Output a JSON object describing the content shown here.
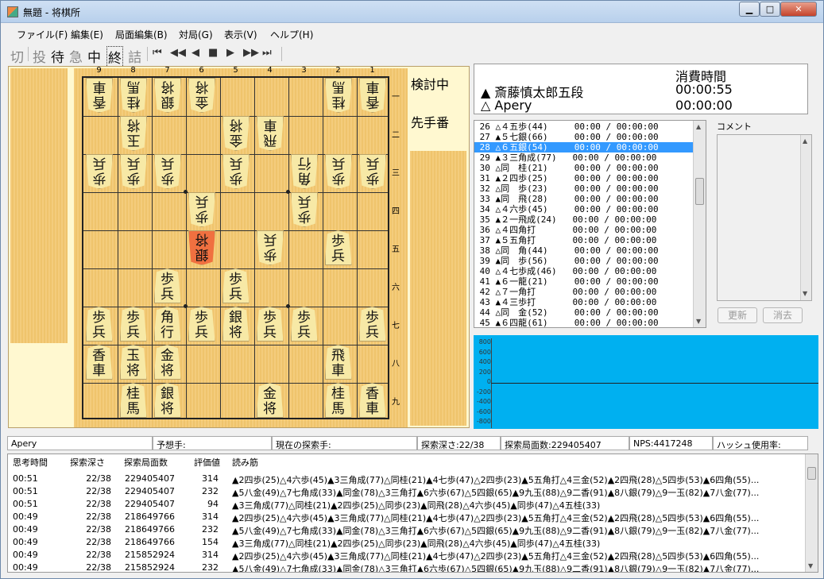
{
  "window": {
    "title": "無題 - 将棋所",
    "min": "▁",
    "max": "□",
    "close": "✕"
  },
  "menu": [
    "ファイル(F)",
    "編集(E)",
    "局面編集(B)",
    "対局(G)",
    "表示(V)",
    "ヘルプ(H)"
  ],
  "toolbar": {
    "buttons": [
      "切",
      "投",
      "待",
      "急",
      "中",
      "終",
      "詰"
    ],
    "nav": [
      "⏮",
      "◀◀",
      "◀",
      "■",
      "▶",
      "▶▶",
      "⏭"
    ]
  },
  "board": {
    "files": [
      "9",
      "8",
      "7",
      "6",
      "5",
      "4",
      "3",
      "2",
      "1"
    ],
    "ranks": [
      "一",
      "二",
      "三",
      "四",
      "五",
      "六",
      "七",
      "八",
      "九"
    ],
    "pieces": [
      {
        "f": 9,
        "r": 1,
        "t": "香車",
        "g": true
      },
      {
        "f": 8,
        "r": 1,
        "t": "桂馬",
        "g": true
      },
      {
        "f": 7,
        "r": 1,
        "t": "銀将",
        "g": true
      },
      {
        "f": 6,
        "r": 1,
        "t": "金将",
        "g": true
      },
      {
        "f": 2,
        "r": 1,
        "t": "桂馬",
        "g": true
      },
      {
        "f": 1,
        "r": 1,
        "t": "香車",
        "g": true
      },
      {
        "f": 8,
        "r": 2,
        "t": "玉将",
        "g": true
      },
      {
        "f": 5,
        "r": 2,
        "t": "金将",
        "g": true
      },
      {
        "f": 4,
        "r": 2,
        "t": "飛車",
        "g": true
      },
      {
        "f": 9,
        "r": 3,
        "t": "歩兵",
        "g": true
      },
      {
        "f": 8,
        "r": 3,
        "t": "歩兵",
        "g": true
      },
      {
        "f": 7,
        "r": 3,
        "t": "歩兵",
        "g": true
      },
      {
        "f": 5,
        "r": 3,
        "t": "歩兵",
        "g": true
      },
      {
        "f": 3,
        "r": 3,
        "t": "角行",
        "g": true
      },
      {
        "f": 2,
        "r": 3,
        "t": "歩兵",
        "g": true
      },
      {
        "f": 1,
        "r": 3,
        "t": "歩兵",
        "g": true
      },
      {
        "f": 6,
        "r": 4,
        "t": "歩兵",
        "g": true
      },
      {
        "f": 3,
        "r": 4,
        "t": "歩兵",
        "g": true
      },
      {
        "f": 6,
        "r": 5,
        "t": "銀将",
        "g": true,
        "hl": true
      },
      {
        "f": 4,
        "r": 5,
        "t": "歩兵",
        "g": true
      },
      {
        "f": 2,
        "r": 5,
        "t": "歩兵",
        "g": false
      },
      {
        "f": 7,
        "r": 6,
        "t": "歩兵",
        "g": false
      },
      {
        "f": 5,
        "r": 6,
        "t": "歩兵",
        "g": false
      },
      {
        "f": 9,
        "r": 7,
        "t": "歩兵",
        "g": false
      },
      {
        "f": 8,
        "r": 7,
        "t": "歩兵",
        "g": false
      },
      {
        "f": 7,
        "r": 7,
        "t": "角行",
        "g": false
      },
      {
        "f": 6,
        "r": 7,
        "t": "歩兵",
        "g": false
      },
      {
        "f": 5,
        "r": 7,
        "t": "銀将",
        "g": false
      },
      {
        "f": 4,
        "r": 7,
        "t": "歩兵",
        "g": false
      },
      {
        "f": 3,
        "r": 7,
        "t": "歩兵",
        "g": false
      },
      {
        "f": 1,
        "r": 7,
        "t": "歩兵",
        "g": false
      },
      {
        "f": 9,
        "r": 8,
        "t": "香車",
        "g": false
      },
      {
        "f": 8,
        "r": 8,
        "t": "玉将",
        "g": false
      },
      {
        "f": 7,
        "r": 8,
        "t": "金将",
        "g": false
      },
      {
        "f": 2,
        "r": 8,
        "t": "飛車",
        "g": false
      },
      {
        "f": 8,
        "r": 9,
        "t": "桂馬",
        "g": false
      },
      {
        "f": 7,
        "r": 9,
        "t": "銀将",
        "g": false
      },
      {
        "f": 4,
        "r": 9,
        "t": "金将",
        "g": false
      },
      {
        "f": 2,
        "r": 9,
        "t": "桂馬",
        "g": false
      },
      {
        "f": 1,
        "r": 9,
        "t": "香車",
        "g": false
      }
    ]
  },
  "side": {
    "mode": "検討中",
    "turn": "先手番"
  },
  "clock": {
    "header": "消費時間",
    "sente_name": "▲ 斎藤慎太郎五段",
    "sente_time": "00:00:55",
    "gote_name": "△ Apery",
    "gote_time": "00:00:00"
  },
  "moves": [
    " 26 △４五歩(44)     00:00 / 00:00:00",
    " 27 ▲５七銀(66)     00:00 / 00:00:00",
    " 28 △６五銀(54)     00:00 / 00:00:00",
    " 29 ▲３三角成(77)   00:00 / 00:00:00",
    " 30 △同　桂(21)     00:00 / 00:00:00",
    " 31 ▲２四歩(25)     00:00 / 00:00:00",
    " 32 △同　歩(23)     00:00 / 00:00:00",
    " 33 ▲同　飛(28)     00:00 / 00:00:00",
    " 34 △４六歩(45)     00:00 / 00:00:00",
    " 35 ▲２一飛成(24)   00:00 / 00:00:00",
    " 36 △４四角打       00:00 / 00:00:00",
    " 37 ▲５五角打       00:00 / 00:00:00",
    " 38 △同　角(44)     00:00 / 00:00:00",
    " 39 ▲同　歩(56)     00:00 / 00:00:00",
    " 40 △４七歩成(46)   00:00 / 00:00:00",
    " 41 ▲６一龍(21)     00:00 / 00:00:00",
    " 42 △７一角打       00:00 / 00:00:00",
    " 43 ▲４三歩打       00:00 / 00:00:00",
    " 44 △同　金(52)     00:00 / 00:00:00",
    " 45 ▲６四龍(61)     00:00 / 00:00:00"
  ],
  "selected_move": 2,
  "comment": {
    "label": "コメント",
    "update": "更新",
    "clear": "消去"
  },
  "graph": {
    "yticks": [
      "800",
      "600",
      "400",
      "200",
      "0",
      "-200",
      "-400",
      "-600",
      "-800"
    ]
  },
  "status": {
    "engine": "Apery",
    "predict": "予想手:",
    "current": "現在の探索手:",
    "depth": "探索深さ:22/38",
    "nodes": "探索局面数:229405407",
    "nps": "NPS:4417248",
    "hash": "ハッシュ使用率:"
  },
  "pv": {
    "headers": [
      "思考時間",
      "探索深さ",
      "探索局面数",
      "評価値",
      "読み筋"
    ],
    "rows": [
      [
        "00:51",
        "22/38",
        "229405407",
        "314",
        "▲2四歩(25)△4六歩(45)▲3三角成(77)△同桂(21)▲4七歩(47)△2四歩(23)▲5五角打△4三金(52)▲2四飛(28)△5四歩(53)▲6四角(55)..."
      ],
      [
        "00:51",
        "22/38",
        "229405407",
        "232",
        "▲5八金(49)△7七角成(33)▲同金(78)△3三角打▲6六歩(67)△5四銀(65)▲9九玉(88)△9二香(91)▲8八銀(79)△9一玉(82)▲7八金(77)..."
      ],
      [
        "00:51",
        "22/38",
        "229405407",
        "94",
        "▲3三角成(77)△同桂(21)▲2四歩(25)△同歩(23)▲同飛(28)△4六歩(45)▲同歩(47)△4五桂(33)"
      ],
      [
        "00:49",
        "22/38",
        "218649766",
        "314",
        "▲2四歩(25)△4六歩(45)▲3三角成(77)△同桂(21)▲4七歩(47)△2四歩(23)▲5五角打△4三金(52)▲2四飛(28)△5四歩(53)▲6四角(55)..."
      ],
      [
        "00:49",
        "22/38",
        "218649766",
        "232",
        "▲5八金(49)△7七角成(33)▲同金(78)△3三角打▲6六歩(67)△5四銀(65)▲9九玉(88)△9二香(91)▲8八銀(79)△9一玉(82)▲7八金(77)..."
      ],
      [
        "00:49",
        "22/38",
        "218649766",
        "154",
        "▲3三角成(77)△同桂(21)▲2四歩(25)△同歩(23)▲同飛(28)△4六歩(45)▲同歩(47)△4五桂(33)"
      ],
      [
        "00:49",
        "22/38",
        "215852924",
        "314",
        "▲2四歩(25)△4六歩(45)▲3三角成(77)△同桂(21)▲4七歩(47)△2四歩(23)▲5五角打△4三金(52)▲2四飛(28)△5四歩(53)▲6四角(55)..."
      ],
      [
        "00:49",
        "22/38",
        "215852924",
        "232",
        "▲5八金(49)△7七角成(33)▲同金(78)△3三角打▲6六歩(67)△5四銀(65)▲9九玉(88)△9二香(91)▲8八銀(79)△9一玉(82)▲7八金(77)..."
      ]
    ]
  }
}
